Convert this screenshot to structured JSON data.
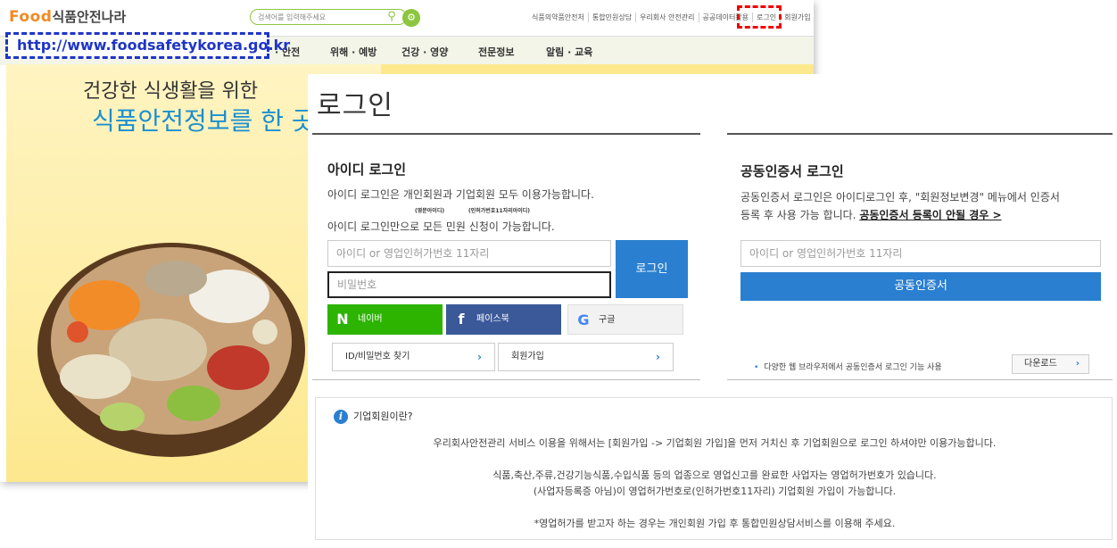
{
  "site": {
    "logo_food": "Food",
    "logo_text": "식품안전나라",
    "search_placeholder": "검색어를 입력해주세요",
    "utility_links": [
      "식품의약품안전처",
      "통합민원상담",
      "우리회사 안전관리",
      "공공데이터활용",
      "로그인",
      "회원가입"
    ],
    "url": "http://www.foodsafetykorea.go.kr",
    "gnb": [
      "· 안전",
      "위해 · 예방",
      "건강 · 영양",
      "전문정보",
      "알림 · 교육"
    ],
    "hero_line1": "건강한 식생활을 위한",
    "hero_line2": "식품안전정보를 한 곳에"
  },
  "login": {
    "page_title": "로그인",
    "id_login": {
      "title": "아이디 로그인",
      "desc1": "아이디 로그인은 개인회원과 기업회원 모두 이용가능합니다.",
      "note1": "(영문아이디)",
      "note2": "(인허가번호11자리아이디)",
      "desc2": "아이디 로그인만으로 모든 민원 신청이 가능합니다.",
      "id_placeholder": "아이디 or 영업인허가번호 11자리",
      "pw_placeholder": "비밀번호",
      "login_button": "로그인",
      "naver": "네이버",
      "facebook": "페이스북",
      "google": "구글",
      "find_id": "ID/비밀번호 찾기",
      "join": "회원가입"
    },
    "cert_login": {
      "title": "공동인증서 로그인",
      "desc1": "공동인증서 로그인은 아이디로그인 후, \"회원정보변경\" 메뉴에서 인증서",
      "desc2": "등록 후 사용 가능 합니다.",
      "desc_link": "공동인증서 등록이 안될 경우 >",
      "id_placeholder": "아이디 or 영업인허가번호 11자리",
      "cert_button": "공동인증서",
      "note": "다양한 웹 브라우저에서 공동인증서 로그인 기능 사용",
      "download": "다운로드"
    },
    "info": {
      "heading": "기업회원이란?",
      "line1": "우리회사안전관리 서비스 이용을 위해서는 [회원가입 -> 기업회원 가입]을 먼저 거치신 후 기업회원으로 로그인 하셔야만 이용가능합니다.",
      "line2": "식품,축산,주류,건강기능식품,수입식품 등의 업종으로 영업신고를 완료한 사업자는 영업허가번호가 있습니다.",
      "line3": "(사업자등록증 아님)이 영업허가번호로(인허가번호11자리) 기업회원 가입이 가능합니다.",
      "line4": "*영업허가를 받고자 하는 경우는 개인회원 가입 후 통합민원상담서비스를 이용해 주세요."
    }
  },
  "colors": {
    "accent_blue": "#2a7fd0",
    "naver_green": "#2db400",
    "facebook_blue": "#3b5998",
    "highlight_red": "#e00000",
    "url_blue": "#1f35c7"
  }
}
